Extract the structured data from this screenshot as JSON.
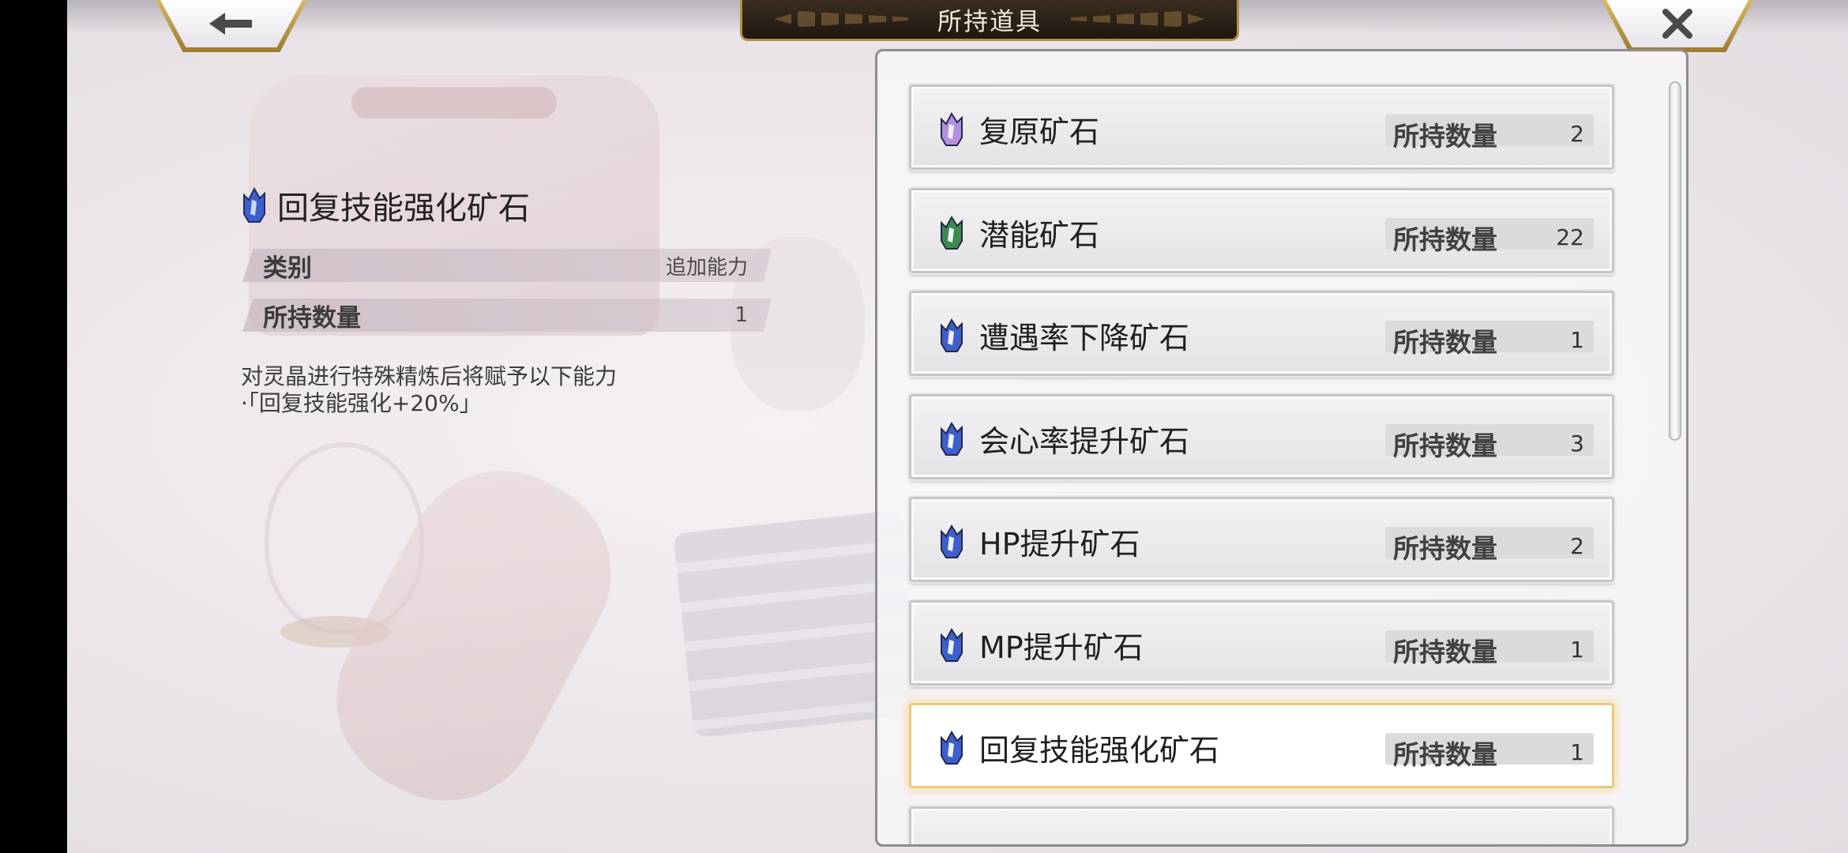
{
  "header": {
    "title": "所持道具",
    "back_icon": "back-arrow-icon",
    "close_icon": "close-x-icon",
    "back_glyph": "🡐",
    "close_glyph": "✕"
  },
  "detail": {
    "name": "回复技能强化矿石",
    "icon": "blue-crystal-icon",
    "category_label": "类别",
    "category_value": "追加能力",
    "owned_label": "所持数量",
    "owned_value": "1",
    "description_line1": "对灵晶进行特殊精炼后将赋予以下能力",
    "description_line2": "·「回复技能强化+20%」"
  },
  "list": {
    "owned_label": "所持数量",
    "items": [
      {
        "name": "复原矿石",
        "count": "2",
        "icon": "purple-crystal-icon",
        "color": "#b48fe0"
      },
      {
        "name": "潜能矿石",
        "count": "22",
        "icon": "green-crystal-icon",
        "color": "#3e8a4c"
      },
      {
        "name": "遭遇率下降矿石",
        "count": "1",
        "icon": "blue-crystal-icon",
        "color": "#3d5fcc"
      },
      {
        "name": "会心率提升矿石",
        "count": "3",
        "icon": "blue-crystal-icon",
        "color": "#3d5fcc"
      },
      {
        "name": "HP提升矿石",
        "count": "2",
        "icon": "blue-crystal-icon",
        "color": "#3d5fcc"
      },
      {
        "name": "MP提升矿石",
        "count": "1",
        "icon": "blue-crystal-icon",
        "color": "#3d5fcc"
      },
      {
        "name": "回复技能强化矿石",
        "count": "1",
        "icon": "blue-crystal-icon",
        "color": "#3d5fcc",
        "selected": true
      },
      {
        "name": "",
        "count": "",
        "icon": "",
        "color": "#3d5fcc"
      }
    ]
  },
  "colors": {
    "selected_glow": "#f7d77f",
    "gold_trim": "#b1904a"
  }
}
